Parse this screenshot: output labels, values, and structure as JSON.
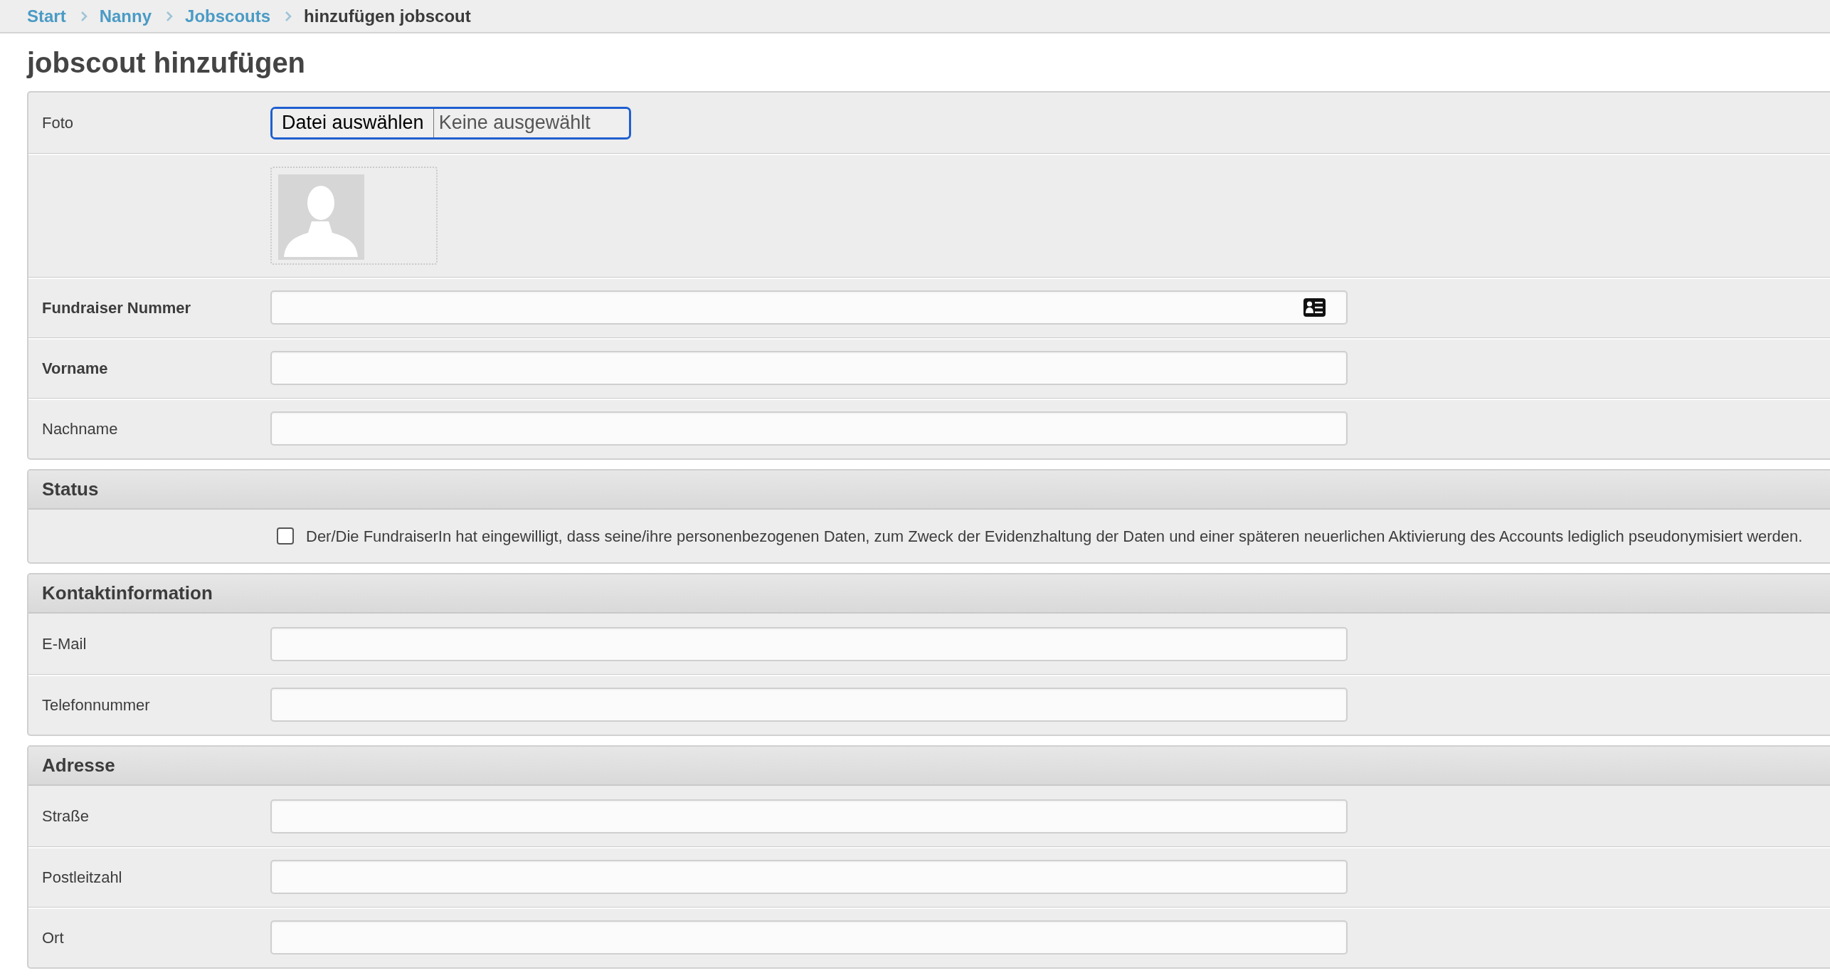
{
  "breadcrumb": [
    {
      "label": "Start",
      "kind": "link"
    },
    {
      "label": "Nanny",
      "kind": "link"
    },
    {
      "label": "Jobscouts",
      "kind": "link"
    },
    {
      "label": "hinzufügen jobscout",
      "kind": "current"
    }
  ],
  "title": "jobscout hinzufügen",
  "sections": [
    {
      "rows": [
        {
          "kind": "file",
          "label": "Foto",
          "bold": false,
          "button": "Datei auswählen",
          "value": "Keine ausgewählt",
          "focused": true
        },
        {
          "kind": "photo"
        },
        {
          "kind": "text",
          "label": "Fundraiser Nummer",
          "bold": true,
          "trailing_icon": true
        },
        {
          "kind": "text",
          "label": "Vorname",
          "bold": true,
          "trailing_icon": false
        },
        {
          "kind": "text",
          "label": "Nachname",
          "bold": false,
          "trailing_icon": false
        }
      ]
    },
    {
      "heading": "Status",
      "rows": [
        {
          "kind": "checkbox",
          "text": "Der/Die FundraiserIn hat eingewilligt, dass seine/ihre personenbezogenen Daten, zum Zweck der Evidenzhaltung der Daten und einer späteren neuerlichen Aktivierung des Accounts lediglich pseudonymisiert werden.",
          "checked": false
        }
      ]
    },
    {
      "heading": "Kontaktinformation",
      "rows": [
        {
          "kind": "text",
          "label": "E-Mail",
          "bold": false,
          "trailing_icon": false
        },
        {
          "kind": "text",
          "label": "Telefonnummer",
          "bold": false,
          "trailing_icon": false
        }
      ]
    },
    {
      "heading": "Adresse",
      "rows": [
        {
          "kind": "text",
          "label": "Straße",
          "bold": false,
          "trailing_icon": false
        },
        {
          "kind": "text",
          "label": "Postleitzahl",
          "bold": false,
          "trailing_icon": false
        },
        {
          "kind": "text",
          "label": "Ort",
          "bold": false,
          "trailing_icon": false
        }
      ]
    }
  ]
}
